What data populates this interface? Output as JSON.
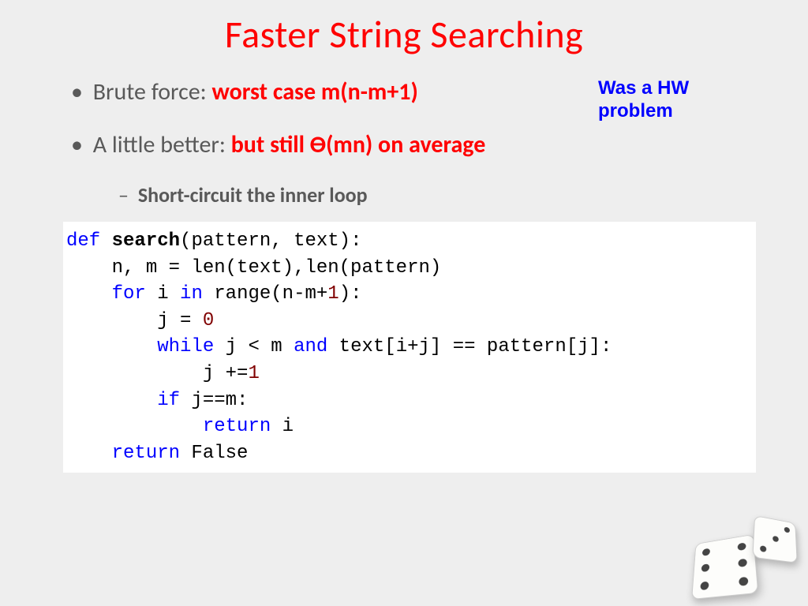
{
  "title": "Faster String Searching",
  "annotation": "Was a HW\nproblem",
  "bullets": {
    "b1_lead": "Brute force: ",
    "b1_em": "worst case m(n-m+1)",
    "b2_lead": "A little better: ",
    "b2_em": "but still Ө(mn) on average",
    "sub1": "Short-circuit the inner loop"
  },
  "code": {
    "kw_def": "def",
    "fn_name": "search",
    "sig_rest": "(pattern, text):",
    "l2": "    n, m = len(text),len(pattern)",
    "l3a": "    ",
    "kw_for": "for",
    "l3b": " i ",
    "kw_in": "in",
    "l3c": " range(n-m+",
    "num1": "1",
    "l3d": "):",
    "l4a": "        j = ",
    "num0": "0",
    "l5a": "        ",
    "kw_while": "while",
    "l5b": " j < m ",
    "kw_and": "and",
    "l5c": " text[i+j] == pattern[j]:",
    "l6a": "            j +=",
    "num1b": "1",
    "l7a": "        ",
    "kw_if": "if",
    "l7b": " j==m:",
    "l8a": "            ",
    "kw_ret1": "return",
    "l8b": " i",
    "l9a": "    ",
    "kw_ret2": "return",
    "l9b": " False"
  }
}
